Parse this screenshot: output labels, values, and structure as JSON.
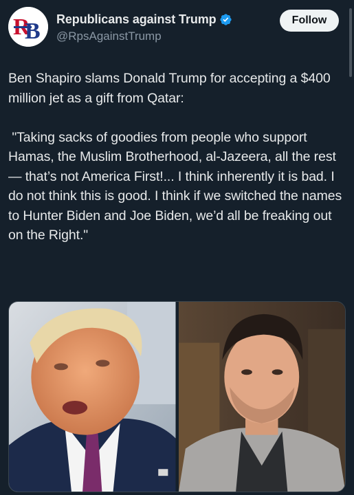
{
  "account": {
    "display_name": "Republicans against Trump",
    "handle": "@RpsAgainstTrump",
    "avatar_icon": "rb-logo-avatar-icon",
    "verified_icon": "verified-badge-icon",
    "verified_color": "#1d9bf0"
  },
  "actions": {
    "follow_label": "Follow"
  },
  "tweet": {
    "text": "Ben Shapiro slams Donald Trump for accepting a $400 million jet as a gift from Qatar:\n\n \"Taking sacks of goodies from people who support Hamas, the Muslim Brotherhood, al-Jazeera, all the rest — that’s not America First!... I think inherently it is bad. I do not think this is good. I think if we switched the names to Hunter Biden and Joe Biden, we’d all be freaking out on the Right.\""
  },
  "media": {
    "photos": [
      {
        "icon": "photo-donald-trump-icon"
      },
      {
        "icon": "photo-ben-shapiro-icon"
      }
    ]
  },
  "colors": {
    "background": "#15202b",
    "text": "#e7e9ea",
    "secondary_text": "#8b98a5",
    "follow_bg": "#eff3f4"
  }
}
